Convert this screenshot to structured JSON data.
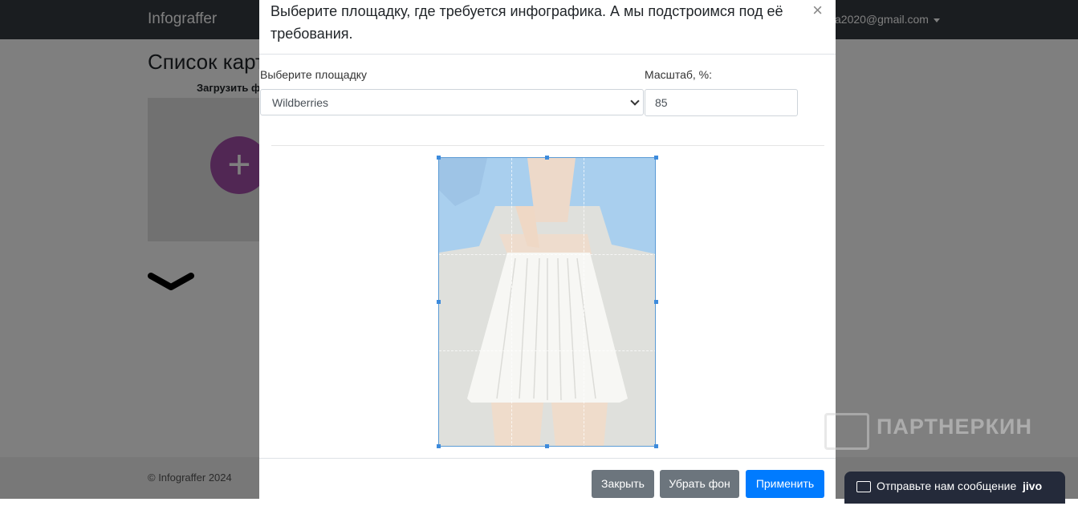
{
  "app": {
    "brand": "Infograffer",
    "user_email": "a2020@gmail.com"
  },
  "page": {
    "title": "Список карт",
    "upload_label": "Загрузить ф",
    "add_icon": "+"
  },
  "footer": {
    "copyright": "© Infograffer 2024"
  },
  "modal": {
    "title": "Выберите площадку, где требуется инфографика. А мы подстроимся под её требования.",
    "close_icon": "×",
    "platform_label": "Выберите площадку",
    "platform_value": "Wildberries",
    "scale_label": "Масштаб, %:",
    "scale_value": "85",
    "buttons": {
      "close": "Закрыть",
      "remove_bg": "Убрать фон",
      "apply": "Применить"
    }
  },
  "watermark": {
    "text": "ПАРТНЕРКИН"
  },
  "chat": {
    "label": "Отправьте нам сообщение",
    "logo": "jivo"
  },
  "colors": {
    "navbar": "#343a40",
    "primary": "#007bff",
    "secondary": "#6c757d",
    "accent": "#a34fa8",
    "chat": "#242a3a"
  }
}
